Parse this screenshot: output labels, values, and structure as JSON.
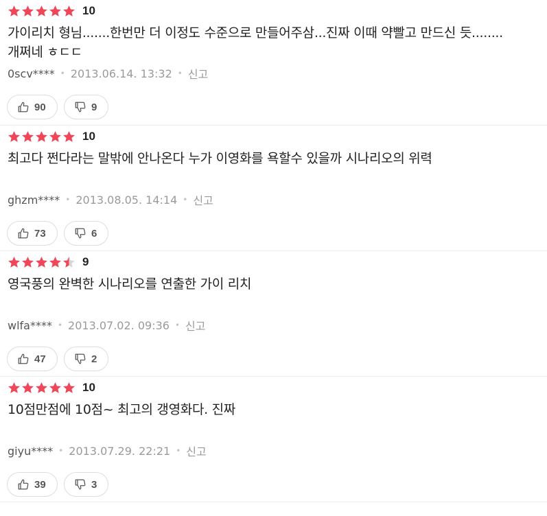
{
  "colors": {
    "star_filled": "#f0465a",
    "star_empty": "#d6d6d6",
    "divider": "#ececec",
    "meta_gray": "#9a9a9a"
  },
  "reviews": [
    {
      "rating_stars": 5,
      "score": "10",
      "text": "가이리치 형님.......한번만 더 이정도 수준으로 만들어주삼...진짜 이때 약빨고 만드신 듯........개쩌네 ㅎㄷㄷ",
      "user": "0scv****",
      "date": "2013.06.14. 13:32",
      "report_label": "신고",
      "likes": "90",
      "dislikes": "9"
    },
    {
      "rating_stars": 5,
      "score": "10",
      "text": "최고다 쩐다라는 말밖에 안나온다 누가 이영화를 욕할수 있을까 시나리오의 위력",
      "user": "ghzm****",
      "date": "2013.08.05. 14:14",
      "report_label": "신고",
      "likes": "73",
      "dislikes": "6"
    },
    {
      "rating_stars": 4.5,
      "score": "9",
      "text": "영국풍의 완벽한 시나리오를 연출한 가이 리치",
      "user": "wlfa****",
      "date": "2013.07.02. 09:36",
      "report_label": "신고",
      "likes": "47",
      "dislikes": "2"
    },
    {
      "rating_stars": 5,
      "score": "10",
      "text": "10점만점에 10점~ 최고의 갱영화다. 진짜",
      "user": "giyu****",
      "date": "2013.07.29. 22:21",
      "report_label": "신고",
      "likes": "39",
      "dislikes": "3"
    }
  ]
}
